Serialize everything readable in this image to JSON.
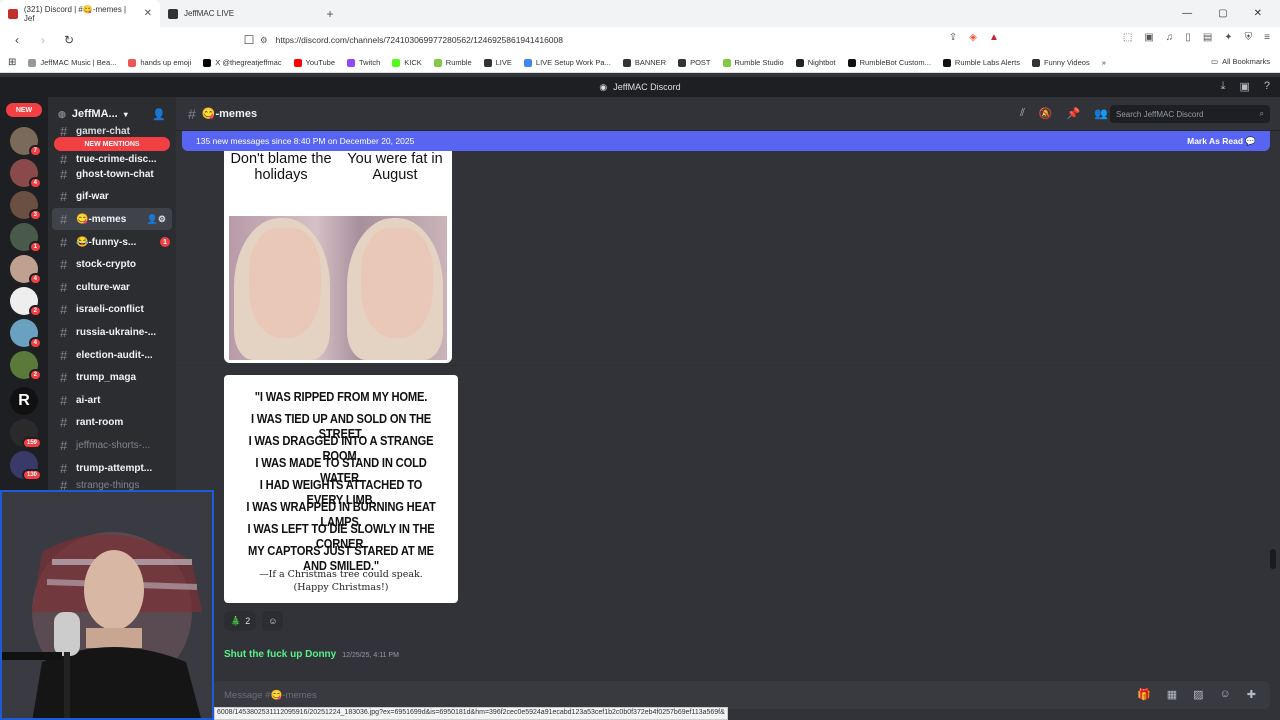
{
  "browser": {
    "tabs": [
      {
        "label": "(321) Discord | #😋-memes | Jef",
        "active": true
      },
      {
        "label": "JeffMAC LIVE",
        "active": false
      }
    ],
    "new_tab": "+",
    "window_controls": [
      "—",
      "▢",
      "✕"
    ],
    "url": "https://discord.com/channels/724103069977280562/1246925861941416008",
    "bookmarks": [
      "JeffMAC Music | Bea...",
      "hands up emoji",
      "X @thegreatjeffmac",
      "YouTube",
      "Twitch",
      "KICK",
      "Rumble",
      "LIVE",
      "LIVE Setup Work Pa...",
      "BANNER",
      "POST",
      "Rumble Studio",
      "Nightbot",
      "RumbleBot Custom...",
      "Rumble Labs Alerts",
      "Funny Videos"
    ],
    "all_bookmarks": "All Bookmarks",
    "status_url": "6008/1453802531112095916/20251224_183036.jpg?ex=6951699d&is=6950181d&hm=396f2cec0e5924a91ecabd123a53cef1b2c0b0f372eb4f0257b69ef113a569f&"
  },
  "discord": {
    "window_title": "JeffMAC Discord",
    "new_pill": "NEW",
    "server_badges": [
      "7",
      "4",
      "3",
      "1",
      "4",
      "2",
      "4",
      "2",
      "",
      "159",
      "130"
    ],
    "guild_name": "JeffMA...",
    "new_mentions": "NEW MENTIONS",
    "channels": [
      {
        "name": "gamer-chat",
        "state": "partial"
      },
      {
        "name": "true-crime-disc...",
        "state": "partial"
      },
      {
        "name": "ghost-town-chat",
        "state": "unread"
      },
      {
        "name": "gif-war",
        "state": "unread"
      },
      {
        "name": "😋-memes",
        "state": "active"
      },
      {
        "name": "😂-funny-s...",
        "state": "unread",
        "badge": "1"
      },
      {
        "name": "stock-crypto",
        "state": "unread"
      },
      {
        "name": "culture-war",
        "state": "unread"
      },
      {
        "name": "israeli-conflict",
        "state": "unread"
      },
      {
        "name": "russia-ukraine-...",
        "state": "unread"
      },
      {
        "name": "election-audit-...",
        "state": "unread"
      },
      {
        "name": "trump_maga",
        "state": "unread"
      },
      {
        "name": "ai-art",
        "state": "unread"
      },
      {
        "name": "rant-room",
        "state": "unread"
      },
      {
        "name": "jeffmac-shorts-...",
        "state": "muted"
      },
      {
        "name": "trump-attempt...",
        "state": "unread"
      },
      {
        "name": "strange-things",
        "state": "partial"
      }
    ],
    "channel_header": "😋-memes",
    "search_placeholder": "Search JeffMAC Discord",
    "new_messages_bar": "135 new messages since 8:40 PM on December 20, 2025",
    "mark_as_read": "Mark As Read",
    "meme1": {
      "left": "Don't blame the holidays",
      "right": "You were fat in August"
    },
    "meme2": {
      "lines": [
        "\"I WAS RIPPED FROM MY HOME.",
        "I WAS TIED UP AND SOLD ON THE STREET.",
        "I WAS DRAGGED INTO A STRANGE ROOM.",
        "I WAS MADE TO STAND IN COLD WATER.",
        "I HAD WEIGHTS ATTACHED TO EVERY LIMB.",
        "I WAS WRAPPED IN BURNING HEAT LAMPS.",
        "I WAS LEFT TO DIE SLOWLY IN THE CORNER.",
        "MY CAPTORS JUST STARED AT ME AND SMILED.\""
      ],
      "sig1": "—If a Christmas tree could speak.",
      "sig2": "(Happy Christmas!)"
    },
    "reaction": {
      "emoji": "🎄",
      "count": "2"
    },
    "next_author": "Shut the fuck up Donny",
    "next_timestamp": "12/25/25, 4:11 PM",
    "composer_placeholder": "Message #😋-memes"
  }
}
